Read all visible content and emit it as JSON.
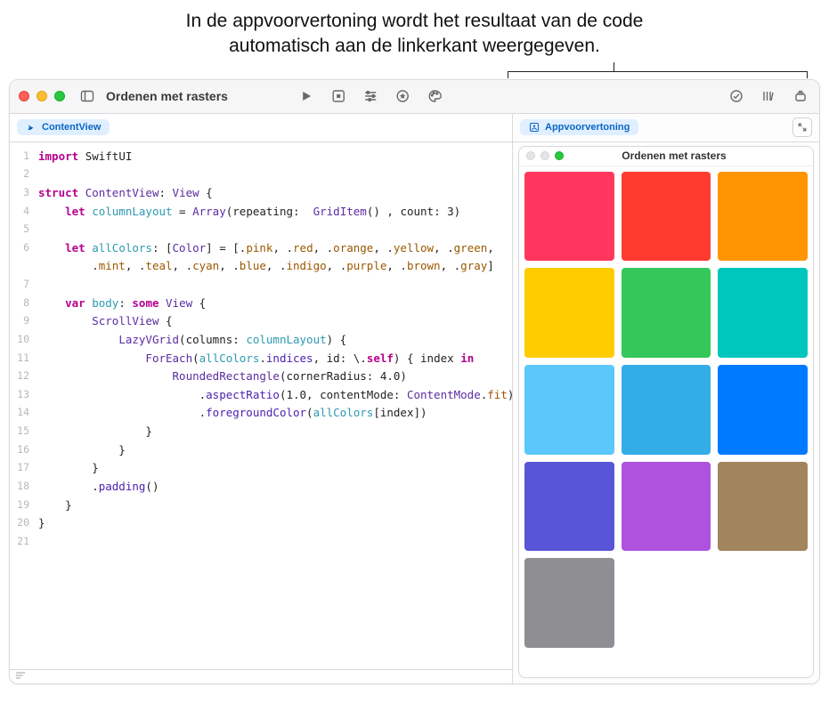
{
  "annotation": "In de appvoorvertoning wordt het resultaat van de code automatisch aan de linkerkant weergegeven.",
  "window_title": "Ordenen met rasters",
  "editor_tab": "ContentView",
  "preview_tab": "Appvoorvertoning",
  "preview_title": "Ordenen met rasters",
  "code": {
    "lines": [
      [
        {
          "t": "import ",
          "c": "kw"
        },
        {
          "t": "SwiftUI",
          "c": "code-text"
        }
      ],
      [],
      [
        {
          "t": "struct ",
          "c": "kw"
        },
        {
          "t": "ContentView",
          "c": "ty"
        },
        {
          "t": ": ",
          "c": "code-text"
        },
        {
          "t": "View",
          "c": "ty"
        },
        {
          "t": " {",
          "c": "code-text"
        }
      ],
      [
        {
          "t": "    ",
          "c": ""
        },
        {
          "t": "let ",
          "c": "kw"
        },
        {
          "t": "columnLayout",
          "c": "pr"
        },
        {
          "t": " = ",
          "c": "code-text"
        },
        {
          "t": "Array",
          "c": "ty"
        },
        {
          "t": "(repeating:  ",
          "c": "code-text"
        },
        {
          "t": "GridItem",
          "c": "ty"
        },
        {
          "t": "() , count: 3)",
          "c": "code-text"
        }
      ],
      [],
      [
        {
          "t": "    ",
          "c": ""
        },
        {
          "t": "let ",
          "c": "kw"
        },
        {
          "t": "allColors",
          "c": "pr"
        },
        {
          "t": ": [",
          "c": "code-text"
        },
        {
          "t": "Color",
          "c": "ty"
        },
        {
          "t": "] = [.",
          "c": "code-text"
        },
        {
          "t": "pink",
          "c": "en"
        },
        {
          "t": ", .",
          "c": "code-text"
        },
        {
          "t": "red",
          "c": "en"
        },
        {
          "t": ", .",
          "c": "code-text"
        },
        {
          "t": "orange",
          "c": "en"
        },
        {
          "t": ", .",
          "c": "code-text"
        },
        {
          "t": "yellow",
          "c": "en"
        },
        {
          "t": ", .",
          "c": "code-text"
        },
        {
          "t": "green",
          "c": "en"
        },
        {
          "t": ",",
          "c": "code-text"
        }
      ],
      [
        {
          "t": "        .",
          "c": "code-text"
        },
        {
          "t": "mint",
          "c": "en"
        },
        {
          "t": ", .",
          "c": "code-text"
        },
        {
          "t": "teal",
          "c": "en"
        },
        {
          "t": ", .",
          "c": "code-text"
        },
        {
          "t": "cyan",
          "c": "en"
        },
        {
          "t": ", .",
          "c": "code-text"
        },
        {
          "t": "blue",
          "c": "en"
        },
        {
          "t": ", .",
          "c": "code-text"
        },
        {
          "t": "indigo",
          "c": "en"
        },
        {
          "t": ", .",
          "c": "code-text"
        },
        {
          "t": "purple",
          "c": "en"
        },
        {
          "t": ", .",
          "c": "code-text"
        },
        {
          "t": "brown",
          "c": "en"
        },
        {
          "t": ", .",
          "c": "code-text"
        },
        {
          "t": "gray",
          "c": "en"
        },
        {
          "t": "]",
          "c": "code-text"
        }
      ],
      [],
      [
        {
          "t": "    ",
          "c": ""
        },
        {
          "t": "var ",
          "c": "kw"
        },
        {
          "t": "body",
          "c": "pr"
        },
        {
          "t": ": ",
          "c": "code-text"
        },
        {
          "t": "some ",
          "c": "kw"
        },
        {
          "t": "View",
          "c": "ty"
        },
        {
          "t": " {",
          "c": "code-text"
        }
      ],
      [
        {
          "t": "        ",
          "c": ""
        },
        {
          "t": "ScrollView",
          "c": "ty"
        },
        {
          "t": " {",
          "c": "code-text"
        }
      ],
      [
        {
          "t": "            ",
          "c": ""
        },
        {
          "t": "LazyVGrid",
          "c": "ty"
        },
        {
          "t": "(columns: ",
          "c": "code-text"
        },
        {
          "t": "columnLayout",
          "c": "pr"
        },
        {
          "t": ") {",
          "c": "code-text"
        }
      ],
      [
        {
          "t": "                ",
          "c": ""
        },
        {
          "t": "ForEach",
          "c": "ty"
        },
        {
          "t": "(",
          "c": "code-text"
        },
        {
          "t": "allColors",
          "c": "pr"
        },
        {
          "t": ".",
          "c": "code-text"
        },
        {
          "t": "indices",
          "c": "fn"
        },
        {
          "t": ", id: \\.",
          "c": "code-text"
        },
        {
          "t": "self",
          "c": "kw"
        },
        {
          "t": ") { index ",
          "c": "code-text"
        },
        {
          "t": "in",
          "c": "kw"
        }
      ],
      [
        {
          "t": "                    ",
          "c": ""
        },
        {
          "t": "RoundedRectangle",
          "c": "ty"
        },
        {
          "t": "(cornerRadius: 4.0)",
          "c": "code-text"
        }
      ],
      [
        {
          "t": "                        .",
          "c": "code-text"
        },
        {
          "t": "aspectRatio",
          "c": "fn"
        },
        {
          "t": "(1.0, contentMode: ",
          "c": "code-text"
        },
        {
          "t": "ContentMode",
          "c": "ty"
        },
        {
          "t": ".",
          "c": "code-text"
        },
        {
          "t": "fit",
          "c": "en"
        },
        {
          "t": ")",
          "c": "code-text"
        }
      ],
      [
        {
          "t": "                        .",
          "c": "code-text"
        },
        {
          "t": "foregroundColor",
          "c": "fn"
        },
        {
          "t": "(",
          "c": "code-text"
        },
        {
          "t": "allColors",
          "c": "pr"
        },
        {
          "t": "[index])",
          "c": "code-text"
        }
      ],
      [
        {
          "t": "                }",
          "c": "code-text"
        }
      ],
      [
        {
          "t": "            }",
          "c": "code-text"
        }
      ],
      [
        {
          "t": "        }",
          "c": "code-text"
        }
      ],
      [
        {
          "t": "        .",
          "c": "code-text"
        },
        {
          "t": "padding",
          "c": "fn"
        },
        {
          "t": "()",
          "c": "code-text"
        }
      ],
      [
        {
          "t": "    }",
          "c": "code-text"
        }
      ],
      [
        {
          "t": "}",
          "c": "code-text"
        }
      ],
      []
    ],
    "line_numbers": [
      "1",
      "2",
      "3",
      "4",
      "5",
      "6",
      "",
      "7",
      "8",
      "9",
      "10",
      "11",
      "12",
      "13",
      "14",
      "15",
      "16",
      "17",
      "18",
      "19",
      "20",
      "21"
    ]
  },
  "grid_colors": [
    "#ff375f",
    "#ff3b30",
    "#ff9500",
    "#ffcc00",
    "#34c759",
    "#00c7be",
    "#5ac8fa",
    "#32ade6",
    "#007aff",
    "#5856d6",
    "#af52de",
    "#a2845e",
    "#8e8e93"
  ]
}
